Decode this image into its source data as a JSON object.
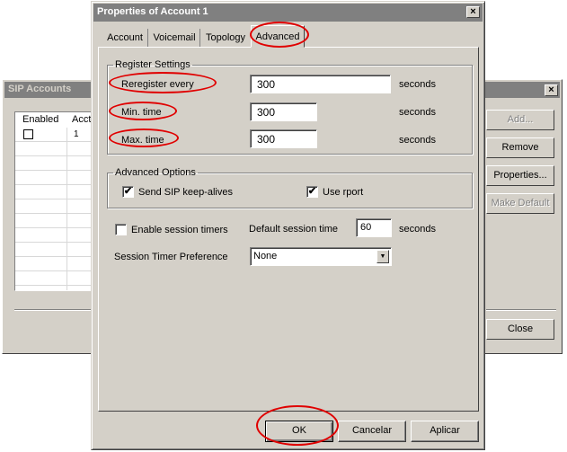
{
  "background_window": {
    "title": "SIP Accounts",
    "close_glyph": "×",
    "list": {
      "headers": [
        "Enabled",
        "Acct"
      ],
      "rows": [
        {
          "enabled": false,
          "acct": "1"
        }
      ]
    },
    "buttons": {
      "add": "Add...",
      "remove": "Remove",
      "properties": "Properties...",
      "make_default": "Make Default",
      "close": "Close"
    }
  },
  "dialog": {
    "title": "Properties of Account 1",
    "close_glyph": "×",
    "tabs": [
      {
        "label": "Account"
      },
      {
        "label": "Voicemail"
      },
      {
        "label": "Topology"
      },
      {
        "label": "Advanced",
        "active": true
      }
    ],
    "register_settings": {
      "legend": "Register Settings",
      "reregister_label": "Reregister every",
      "reregister_value": "300",
      "min_label": "Min. time",
      "min_value": "300",
      "max_label": "Max. time",
      "max_value": "300",
      "unit": "seconds"
    },
    "advanced_options": {
      "legend": "Advanced Options",
      "keepalive_label": "Send SIP keep-alives",
      "keepalive_checked": true,
      "rport_label": "Use rport",
      "rport_checked": true,
      "check_glyph": "✔"
    },
    "session": {
      "enable_label": "Enable session timers",
      "enable_checked": false,
      "default_time_label": "Default session time",
      "default_time_value": "60",
      "unit": "seconds",
      "preference_label": "Session Timer Preference",
      "preference_value": "None",
      "dropdown_glyph": "▼"
    },
    "buttons": {
      "ok": "OK",
      "cancel": "Cancelar",
      "apply": "Aplicar"
    }
  },
  "colors": {
    "face": "#d4d0c8",
    "title_inactive": "#808080",
    "highlight_ring": "#e00000"
  }
}
